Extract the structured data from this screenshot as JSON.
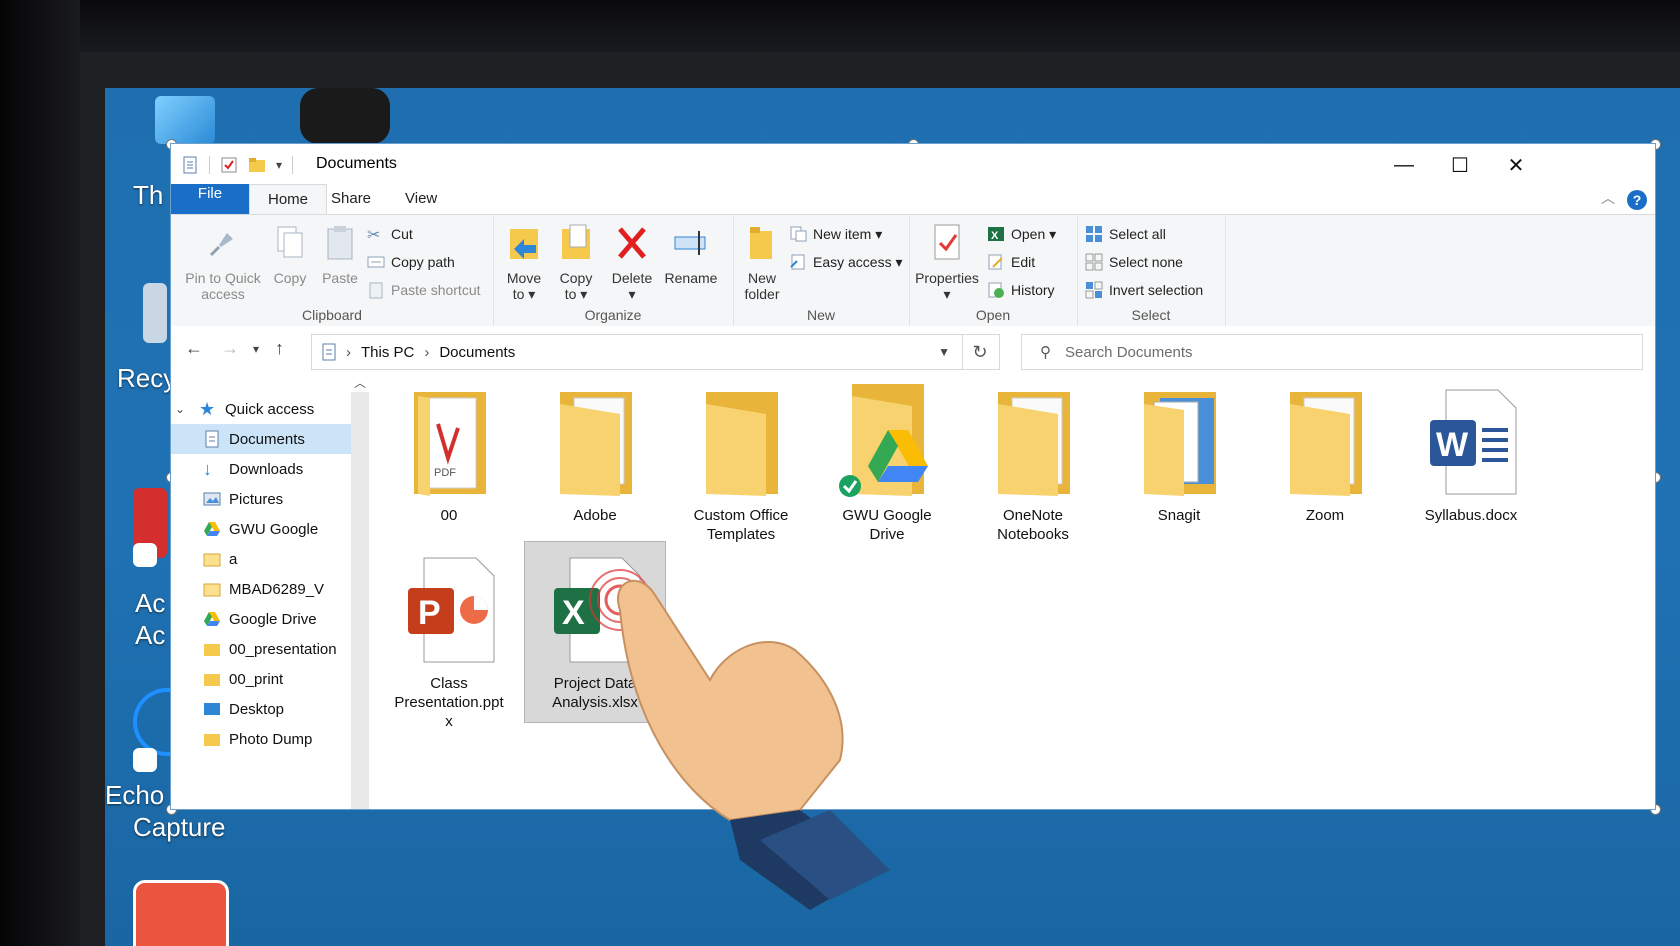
{
  "window": {
    "title": "Documents"
  },
  "tabs": {
    "file": "File",
    "home": "Home",
    "share": "Share",
    "view": "View"
  },
  "ribbon": {
    "clipboard": {
      "label": "Clipboard",
      "pin_line1": "Pin to Quick",
      "pin_line2": "access",
      "copy": "Copy",
      "paste": "Paste",
      "cut": "Cut",
      "copy_path": "Copy path",
      "paste_shortcut": "Paste shortcut"
    },
    "organize": {
      "label": "Organize",
      "move_to_line1": "Move",
      "move_to_line2": "to ▾",
      "copy_to_line1": "Copy",
      "copy_to_line2": "to ▾",
      "delete_line1": "Delete",
      "delete_line2": "▾",
      "rename": "Rename"
    },
    "new": {
      "label": "New",
      "new_folder_line1": "New",
      "new_folder_line2": "folder",
      "new_item": "New item ▾",
      "easy_access": "Easy access ▾"
    },
    "open": {
      "label": "Open",
      "properties_line1": "Properties",
      "properties_line2": "▾",
      "open": "Open ▾",
      "edit": "Edit",
      "history": "History"
    },
    "select": {
      "label": "Select",
      "select_all": "Select all",
      "select_none": "Select none",
      "invert_selection": "Invert selection"
    }
  },
  "address": {
    "crumb1": "This PC",
    "crumb2": "Documents",
    "search_placeholder": "Search Documents"
  },
  "sidebar": {
    "items": [
      {
        "label": "Quick access"
      },
      {
        "label": "Documents"
      },
      {
        "label": "Downloads"
      },
      {
        "label": "Pictures"
      },
      {
        "label": "GWU Google"
      },
      {
        "label": "a"
      },
      {
        "label": "MBAD6289_V"
      },
      {
        "label": "Google Drive"
      },
      {
        "label": "00_presentation"
      },
      {
        "label": "00_print"
      },
      {
        "label": "Desktop"
      },
      {
        "label": "Photo Dump"
      }
    ]
  },
  "files": [
    {
      "line1": "00",
      "line2": ""
    },
    {
      "line1": "Adobe",
      "line2": ""
    },
    {
      "line1": "Custom Office",
      "line2": "Templates"
    },
    {
      "line1": "GWU Google",
      "line2": "Drive"
    },
    {
      "line1": "OneNote",
      "line2": "Notebooks"
    },
    {
      "line1": "Snagit",
      "line2": ""
    },
    {
      "line1": "Zoom",
      "line2": ""
    },
    {
      "line1": "Syllabus.docx",
      "line2": ""
    },
    {
      "line1": "Class",
      "line2": "Presentation.ppt",
      "line3": "x"
    },
    {
      "line1": "Project Data",
      "line2": "Analysis.xlsx"
    }
  ],
  "desktop": {
    "icon1": "Th",
    "icon2": "Recy",
    "icon3_line1": "Ac",
    "icon3_line2": "Ac",
    "icon4_line1": "Echo",
    "icon4_line2": "Capture"
  },
  "colors": {
    "accent": "#1a6ec8",
    "folder": "#f5c94c",
    "selection": "#cce4f7"
  }
}
